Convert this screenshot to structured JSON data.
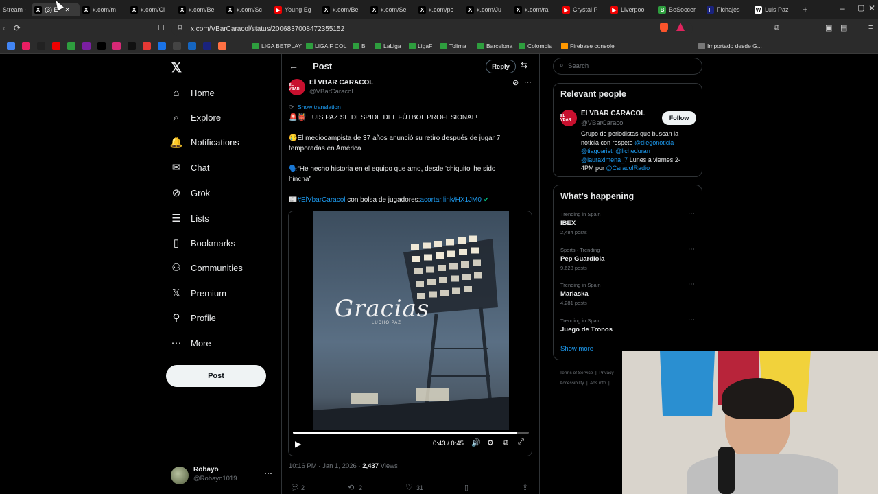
{
  "browser": {
    "tabs": [
      {
        "label": "Stream -",
        "color": "#3a3a3a",
        "icon": ""
      },
      {
        "label": "(3) E",
        "color": "#000",
        "icon": "X"
      },
      {
        "label": "x.com/m",
        "color": "#000",
        "icon": "X"
      },
      {
        "label": "x.com/Cl",
        "color": "#000",
        "icon": "X"
      },
      {
        "label": "x.com/Be",
        "color": "#000",
        "icon": "X"
      },
      {
        "label": "x.com/Sc",
        "color": "#000",
        "icon": "X"
      },
      {
        "label": "Young Eg",
        "color": "#e00",
        "icon": "▶"
      },
      {
        "label": "x.com/Be",
        "color": "#000",
        "icon": "X"
      },
      {
        "label": "x.com/Se",
        "color": "#000",
        "icon": "X"
      },
      {
        "label": "x.com/pc",
        "color": "#000",
        "icon": "X"
      },
      {
        "label": "x.com/Ju",
        "color": "#000",
        "icon": "X"
      },
      {
        "label": "x.com/ra",
        "color": "#000",
        "icon": "X"
      },
      {
        "label": "Crystal P",
        "color": "#e00",
        "icon": "▶"
      },
      {
        "label": "Liverpool",
        "color": "#e00",
        "icon": "▶"
      },
      {
        "label": "BeSoccer",
        "color": "#2e9e3e",
        "icon": "B"
      },
      {
        "label": "Fichajes",
        "color": "#1a237e",
        "icon": "F"
      },
      {
        "label": "Luis Paz",
        "color": "#fff",
        "icon": "W"
      }
    ],
    "url": "x.com/VBarCaracol/status/2006837008472355152",
    "bookmarks": [
      "LIGA BETPLAY",
      "LIGA F COL",
      "B",
      "LaLiga",
      "LigaF",
      "Tolima",
      "Barcelona",
      "Colombia",
      "Firebase console",
      "Importado desde G..."
    ]
  },
  "nav": {
    "items": [
      {
        "label": "Home",
        "icon": "home-icon",
        "glyph": "⌂"
      },
      {
        "label": "Explore",
        "icon": "search-icon",
        "glyph": "⌕"
      },
      {
        "label": "Notifications",
        "icon": "bell-icon",
        "glyph": "🔔"
      },
      {
        "label": "Chat",
        "icon": "mail-icon",
        "glyph": "✉"
      },
      {
        "label": "Grok",
        "icon": "grok-icon",
        "glyph": "⊘"
      },
      {
        "label": "Lists",
        "icon": "list-icon",
        "glyph": "☰"
      },
      {
        "label": "Bookmarks",
        "icon": "bookmark-icon",
        "glyph": "▯"
      },
      {
        "label": "Communities",
        "icon": "communities-icon",
        "glyph": "⚇"
      },
      {
        "label": "Premium",
        "icon": "x-premium-icon",
        "glyph": "𝕏"
      },
      {
        "label": "Profile",
        "icon": "profile-icon",
        "glyph": "⚲"
      },
      {
        "label": "More",
        "icon": "more-icon",
        "glyph": "⋯"
      }
    ],
    "post_button": "Post",
    "account": {
      "name": "Robayo",
      "handle": "@Robayo1019"
    }
  },
  "post": {
    "header_title": "Post",
    "reply_button": "Reply",
    "author_name": "El VBAR CARACOL",
    "author_handle": "@VBarCaracol",
    "avatar_text": "EL VBAR",
    "show_translation": "Show translation",
    "line1": "🚨👹¡LUIS PAZ SE DESPIDE DEL FÚTBOL PROFESIONAL!",
    "line2a": "😢El mediocampista de 37 años anunció su retiro después de jugar 7",
    "line2b": "temporadas en América",
    "line3a": "🗣️“He hecho historia en el equipo que amo, desde 'chiquito' he sido",
    "line3b": "hincha”",
    "hashtag": "#ElVbarCaracol",
    "line4_mid": " con bolsa de jugadores:",
    "short_link": "acortar.link/HX1JM0",
    "video_overlay_title": "Gracias",
    "video_overlay_sub": "LUCHO PAZ",
    "video_time": "0:43 / 0:45",
    "video_progress": 0.95,
    "timestamp": "10:16 PM · Jan 1, 2026 · ",
    "views_count": "2,437",
    "views_label": " Views",
    "replies": "2",
    "reposts": "2",
    "likes": "31"
  },
  "sidebar": {
    "search_placeholder": "Search",
    "relevant_title": "Relevant people",
    "person": {
      "name": "El VBAR CARACOL",
      "handle": "@VBarCaracol",
      "follow": "Follow",
      "bio1": "Grupo de periodistas que buscan la",
      "bio2a": "noticia con respeto ",
      "bio2b": "@diegonoticia",
      "bio3a": "@tiagoaristi @licheduran",
      "bio4a": "@lauraximena_7",
      "bio4b": " Lunes a viernes 2-",
      "bio5a": "4PM por ",
      "bio5b": "@CaracolRadio"
    },
    "happening_title": "What’s happening",
    "trends": [
      {
        "context": "Trending in Spain",
        "name": "IBEX",
        "posts": "2,484 posts"
      },
      {
        "context": "Sports · Trending",
        "name": "Pep Guardiola",
        "posts": "9,628 posts"
      },
      {
        "context": "Trending in Spain",
        "name": "Marlaska",
        "posts": "4,281 posts"
      },
      {
        "context": "Trending in Spain",
        "name": "Juego de Tronos",
        "posts": ""
      }
    ],
    "show_more": "Show more",
    "footer1": "Terms of Service  |  Privacy",
    "footer2": "Accessibility  |  Ads info  |"
  }
}
